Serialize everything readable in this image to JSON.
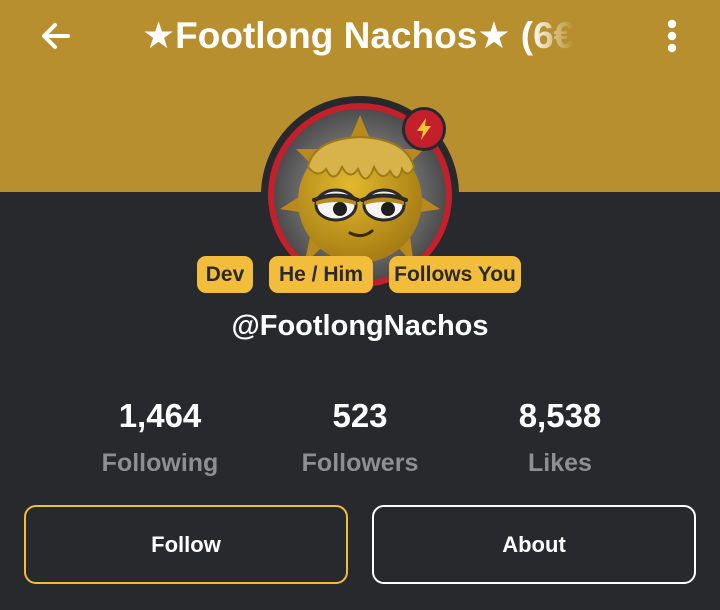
{
  "header": {
    "title": "★Footlong Nachos★ (6€",
    "back_icon": "arrow-left-icon",
    "menu_icon": "more-vertical-icon"
  },
  "profile": {
    "avatar_icon": "sleepy-face-avatar",
    "badge_icon": "lightning-bolt-icon",
    "tags": [
      "Dev",
      "He / Him",
      "Follows You"
    ],
    "handle": "@FootlongNachos"
  },
  "stats": [
    {
      "value": "1,464",
      "label": "Following"
    },
    {
      "value": "523",
      "label": "Followers"
    },
    {
      "value": "8,538",
      "label": "Likes"
    }
  ],
  "actions": {
    "follow_label": "Follow",
    "about_label": "About"
  },
  "colors": {
    "banner": "#b88f2e",
    "background": "#28292d",
    "accent": "#f3bd3c",
    "badge": "#c4202b",
    "muted_text": "#8e8f93"
  }
}
